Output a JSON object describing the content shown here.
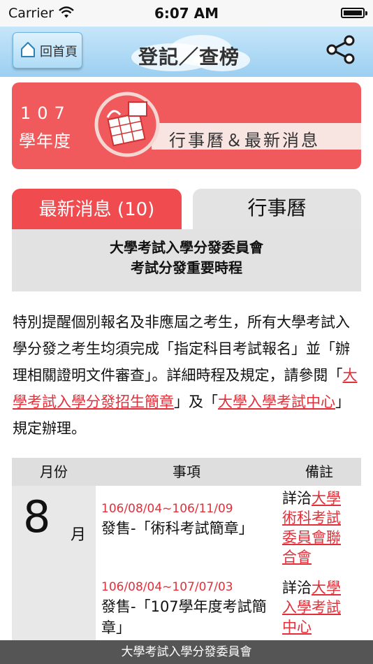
{
  "status_bar": {
    "carrier": "Carrier",
    "time": "6:07 AM"
  },
  "nav": {
    "home_label": "回首頁",
    "logo_text": "登記／查榜",
    "colors": {
      "nav_top": "#c6e6fa",
      "nav_bottom": "#9ccff1"
    }
  },
  "banner": {
    "year": "107",
    "grade": "學年度",
    "title": "行事曆＆最新消息",
    "color": "#f05a5c"
  },
  "tabs": {
    "news": "最新消息 (10)",
    "calendar": "行事曆",
    "active": "news",
    "active_color": "#f04c4f"
  },
  "heading": {
    "line1": "大學考試入學分發委員會",
    "line2": "考試分發重要時程"
  },
  "notice": {
    "text1": "特別提醒個別報名及非應屆之考生，所有大學考試入學分發之考生均須完成「指定科目考試報名」並「辦理相關證明文件審查」。詳細時程及規定，請參閱「",
    "link1": "大學考試入學分發招生簡章",
    "text2": "」及「",
    "link2": "大學入學考試中心",
    "text3": "」規定辦理。"
  },
  "table": {
    "headers": {
      "month": "月份",
      "item": "事項",
      "note": "備註"
    },
    "month": {
      "number": "8",
      "unit": "月"
    },
    "events": [
      {
        "date": "106/08/04~106/11/09",
        "desc": "發售-「術科考試簡章」",
        "note_prefix": "詳洽",
        "note_link": "大學術科考試委員會聯合會"
      },
      {
        "date": "106/08/04~107/07/03",
        "desc": "發售-「107學年度考試簡章」",
        "note_prefix": "詳洽",
        "note_link": "大學入學考試中心"
      }
    ]
  },
  "footer": {
    "text": "大學考試入學分發委員會"
  }
}
